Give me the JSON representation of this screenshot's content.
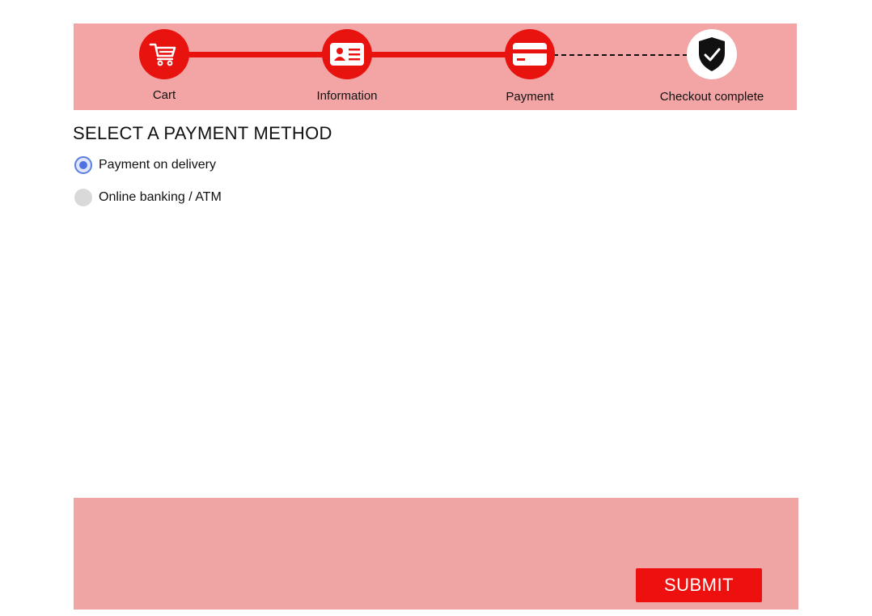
{
  "steps": [
    {
      "label": "Cart",
      "icon": "cart-icon"
    },
    {
      "label": "Information",
      "icon": "id-card-icon"
    },
    {
      "label": "Payment",
      "icon": "credit-card-icon"
    },
    {
      "label": "Checkout complete",
      "icon": "shield-check-icon"
    }
  ],
  "page": {
    "title": "SELECT A PAYMENT METHOD"
  },
  "payment_options": [
    {
      "label": "Payment on delivery",
      "selected": true
    },
    {
      "label": "Online banking / ATM",
      "selected": false
    }
  ],
  "footer": {
    "submit_label": "SUBMIT"
  },
  "colors": {
    "accent": "#e8120f",
    "panel": "#f3a5a5",
    "radio_selected": "#4f72e0"
  }
}
